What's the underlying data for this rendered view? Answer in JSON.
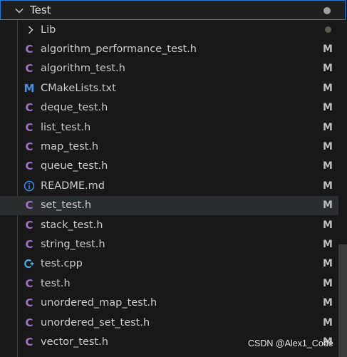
{
  "folder": {
    "name": "Test",
    "expanded": true,
    "status_dot_color": "#a0a0a0"
  },
  "colors": {
    "accent_border": "#2b79d0",
    "text": "#cccccc",
    "modified_status": "#bdbdbd",
    "c_icon": "#a074c4",
    "cmake_icon": "#4a8fe0",
    "info_icon": "#3794ff",
    "cpp_icon": "#4eaadc",
    "lib_dot": "#5e5a50"
  },
  "items": [
    {
      "label": "Lib",
      "type": "folder",
      "icon": "chevron-right-icon",
      "status": "",
      "status_dot": true
    },
    {
      "label": "algorithm_performance_test.h",
      "type": "file",
      "icon": "c-header-icon",
      "icon_glyph": "C",
      "status": "M"
    },
    {
      "label": "algorithm_test.h",
      "type": "file",
      "icon": "c-header-icon",
      "icon_glyph": "C",
      "status": "M"
    },
    {
      "label": "CMakeLists.txt",
      "type": "file",
      "icon": "cmake-icon",
      "icon_glyph": "M",
      "status": "M"
    },
    {
      "label": "deque_test.h",
      "type": "file",
      "icon": "c-header-icon",
      "icon_glyph": "C",
      "status": "M"
    },
    {
      "label": "list_test.h",
      "type": "file",
      "icon": "c-header-icon",
      "icon_glyph": "C",
      "status": "M"
    },
    {
      "label": "map_test.h",
      "type": "file",
      "icon": "c-header-icon",
      "icon_glyph": "C",
      "status": "M"
    },
    {
      "label": "queue_test.h",
      "type": "file",
      "icon": "c-header-icon",
      "icon_glyph": "C",
      "status": "M"
    },
    {
      "label": "README.md",
      "type": "file",
      "icon": "info-icon",
      "icon_glyph": "",
      "status": "M"
    },
    {
      "label": "set_test.h",
      "type": "file",
      "icon": "c-header-icon",
      "icon_glyph": "C",
      "status": "M",
      "selected": true
    },
    {
      "label": "stack_test.h",
      "type": "file",
      "icon": "c-header-icon",
      "icon_glyph": "C",
      "status": "M"
    },
    {
      "label": "string_test.h",
      "type": "file",
      "icon": "c-header-icon",
      "icon_glyph": "C",
      "status": "M"
    },
    {
      "label": "test.cpp",
      "type": "file",
      "icon": "cpp-icon",
      "icon_glyph": "",
      "status": "M"
    },
    {
      "label": "test.h",
      "type": "file",
      "icon": "c-header-icon",
      "icon_glyph": "C",
      "status": "M"
    },
    {
      "label": "unordered_map_test.h",
      "type": "file",
      "icon": "c-header-icon",
      "icon_glyph": "C",
      "status": "M"
    },
    {
      "label": "unordered_set_test.h",
      "type": "file",
      "icon": "c-header-icon",
      "icon_glyph": "C",
      "status": "M"
    },
    {
      "label": "vector_test.h",
      "type": "file",
      "icon": "c-header-icon",
      "icon_glyph": "C",
      "status": "M"
    }
  ],
  "watermark": "CSDN @Alex1_Code"
}
